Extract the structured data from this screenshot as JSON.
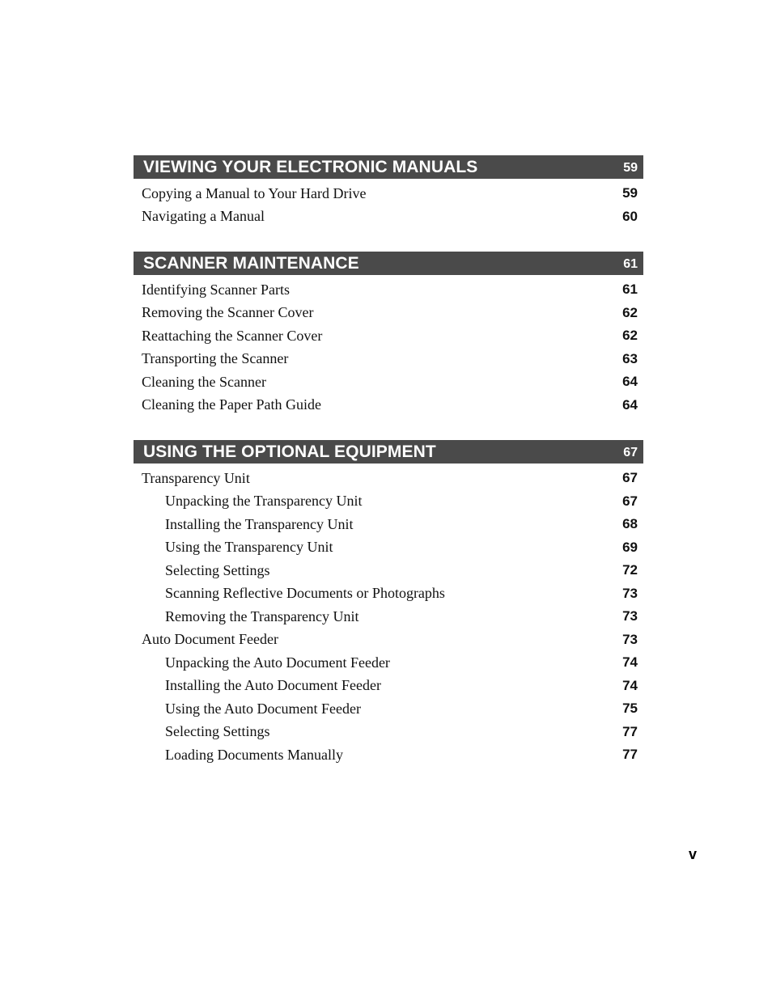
{
  "sections": [
    {
      "title": "VIEWING YOUR ELECTRONIC MANUALS",
      "page": "59",
      "entries": [
        {
          "title": "Copying a Manual to Your Hard Drive",
          "page": "59",
          "level": 1
        },
        {
          "title": "Navigating a Manual",
          "page": "60",
          "level": 1
        }
      ]
    },
    {
      "title": "SCANNER MAINTENANCE",
      "page": "61",
      "entries": [
        {
          "title": "Identifying Scanner Parts",
          "page": "61",
          "level": 1
        },
        {
          "title": "Removing the Scanner Cover",
          "page": "62",
          "level": 1
        },
        {
          "title": "Reattaching the Scanner Cover",
          "page": "62",
          "level": 1
        },
        {
          "title": "Transporting the Scanner",
          "page": "63",
          "level": 1
        },
        {
          "title": "Cleaning the Scanner",
          "page": "64",
          "level": 1
        },
        {
          "title": "Cleaning the Paper Path Guide",
          "page": "64",
          "level": 1
        }
      ]
    },
    {
      "title": "USING THE OPTIONAL EQUIPMENT",
      "page": "67",
      "entries": [
        {
          "title": "Transparency Unit",
          "page": "67",
          "level": 1
        },
        {
          "title": "Unpacking the Transparency Unit",
          "page": "67",
          "level": 2
        },
        {
          "title": "Installing the Transparency Unit",
          "page": "68",
          "level": 2
        },
        {
          "title": "Using the Transparency Unit",
          "page": "69",
          "level": 2
        },
        {
          "title": "Selecting Settings",
          "page": "72",
          "level": 2
        },
        {
          "title": "Scanning Reflective Documents or Photographs",
          "page": "73",
          "level": 2
        },
        {
          "title": "Removing the Transparency Unit",
          "page": "73",
          "level": 2
        },
        {
          "title": "Auto Document Feeder",
          "page": "73",
          "level": 1
        },
        {
          "title": "Unpacking the Auto Document Feeder",
          "page": "74",
          "level": 2
        },
        {
          "title": "Installing the Auto Document Feeder",
          "page": "74",
          "level": 2
        },
        {
          "title": "Using the Auto Document Feeder",
          "page": "75",
          "level": 2
        },
        {
          "title": "Selecting Settings",
          "page": "77",
          "level": 2
        },
        {
          "title": "Loading Documents Manually",
          "page": "77",
          "level": 2
        }
      ]
    }
  ],
  "folio": "v",
  "colors": {
    "header_bg": "#4a4a4a",
    "header_text": "#ffffff"
  }
}
